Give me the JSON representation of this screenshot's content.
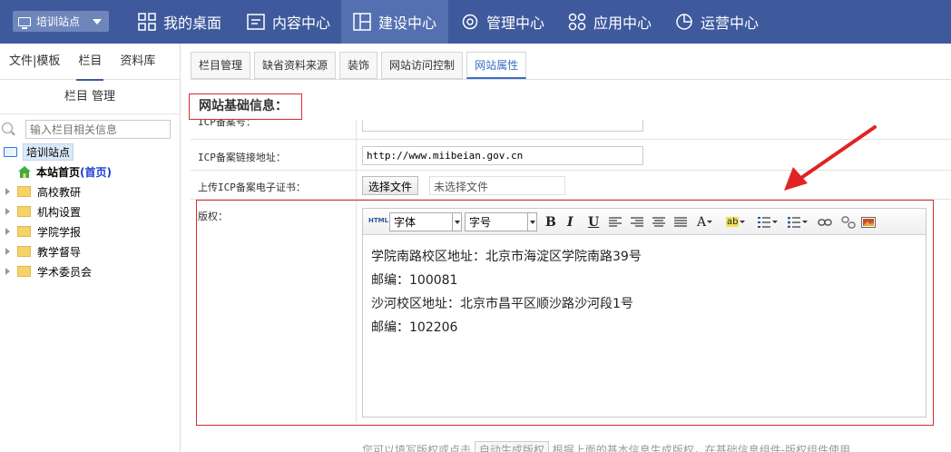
{
  "header": {
    "site_selector": "培训站点",
    "nav": [
      {
        "label": "我的桌面",
        "icon": "grid-icon"
      },
      {
        "label": "内容中心",
        "icon": "document-icon"
      },
      {
        "label": "建设中心",
        "icon": "layout-icon",
        "active": true
      },
      {
        "label": "管理中心",
        "icon": "gear-icon"
      },
      {
        "label": "应用中心",
        "icon": "apps-icon"
      },
      {
        "label": "运营中心",
        "icon": "pie-chart-icon"
      }
    ]
  },
  "sidebar": {
    "tabs": [
      "文件|模板",
      "栏目",
      "资料库"
    ],
    "active_tab": "栏目",
    "title": "栏目 管理",
    "search_placeholder": "输入栏目相关信息",
    "tree": {
      "root": "培训站点",
      "home_label": "本站首页",
      "home_suffix": "(首页)",
      "folders": [
        "高校教研",
        "机构设置",
        "学院学报",
        "教学督导",
        "学术委员会"
      ]
    }
  },
  "content_tabs": [
    "栏目管理",
    "缺省资料来源",
    "装饰",
    "网站访问控制",
    "网站属性"
  ],
  "active_content_tab": "网站属性",
  "section_title": "网站基础信息：",
  "form": {
    "icp_no_label": "ICP备案号：",
    "icp_link_label": "ICP备案链接地址：",
    "icp_link_value": "http://www.miibeian.gov.cn",
    "icp_cert_label": "上传ICP备案电子证书：",
    "choose_file": "选择文件",
    "no_file": "未选择文件",
    "copyright_label": "版权："
  },
  "editor": {
    "html_btn": "HTML",
    "font_label": "字体",
    "size_label": "字号",
    "bold": "B",
    "italic": "I",
    "underline": "U",
    "font_color": "A",
    "highlight": "ab",
    "lines": [
      "学院南路校区地址：北京市海淀区学院南路39号",
      "邮编：100081",
      "沙河校区地址：北京市昌平区顺沙路沙河段1号",
      "邮编：102206"
    ]
  },
  "help": {
    "prefix": "您可以填写版权或点击",
    "button": "自动生成版权",
    "suffix": "根据上面的基本信息生成版权，在基础信息组件-版权组件使用"
  },
  "colors": {
    "header_bg": "#3e5a9c",
    "accent_red": "#d92b2b"
  }
}
